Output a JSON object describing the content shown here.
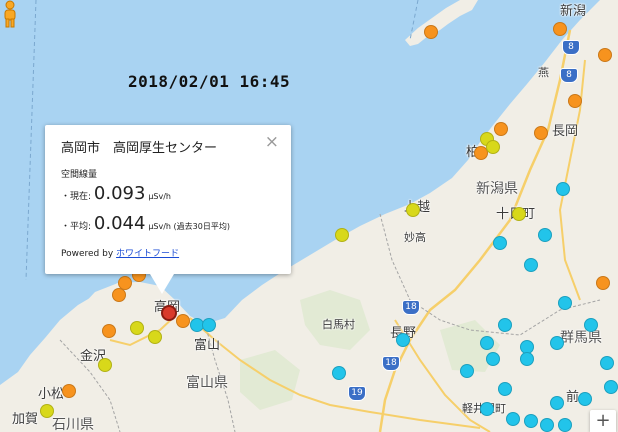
{
  "timestamp": "2018/02/01 16:45",
  "info_window": {
    "title": "高岡市　高岡厚生センター",
    "subtitle": "空間線量",
    "current_label": "・現在:",
    "current_value": "0.093",
    "unit": "μSv/h",
    "average_label": "・平均:",
    "average_value": "0.044",
    "average_unit": "μSv/h (過去30日平均)",
    "powered_by": "Powered by",
    "powered_link": "ホワイトフード",
    "close_symbol": "×"
  },
  "places": {
    "niigata": "新潟",
    "tsubame": "燕",
    "nagaoka": "長岡",
    "kashiwazaki": "柏",
    "niigata_pref": "新潟県",
    "joetsu": "上越",
    "tokamachi": "十日町",
    "myoko": "妙高",
    "takaoka": "高岡",
    "kanazawa": "金沢",
    "toyama": "富山",
    "toyama_pref": "富山県",
    "hakuba": "白馬村",
    "nagano": "長野",
    "gunma_pref": "群馬県",
    "komatsu": "小松",
    "kaga": "加賀",
    "ishikawa_pref": "石川県",
    "karuizawa": "軽井沢町",
    "mae": "前"
  },
  "routes": {
    "r8a": "8",
    "r8b": "8",
    "r18a": "18",
    "r18b": "18",
    "r19": "19"
  },
  "zoom_in": "+",
  "colors": {
    "sea": "#a9d3f2",
    "land": "#f1eee6",
    "marker_orange": "#f7931e",
    "marker_yellow": "#d8d81a",
    "marker_cyan": "#22c4ea",
    "marker_red": "#d93a2b"
  }
}
